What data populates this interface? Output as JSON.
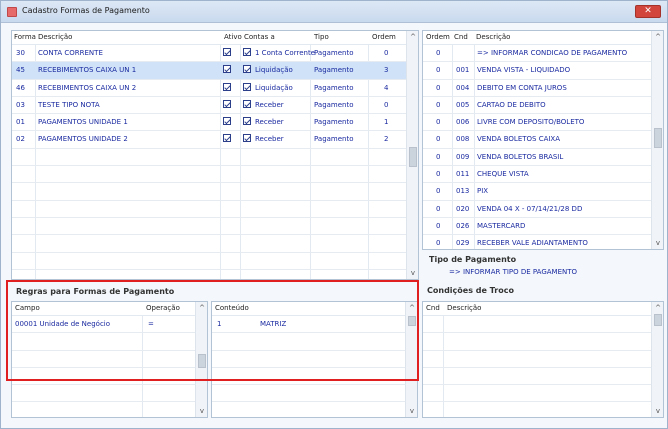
{
  "window": {
    "title": "Cadastro Formas de Pagamento"
  },
  "formas": {
    "headers": [
      "Forma",
      "Descrição",
      "Ativo",
      "Contas a",
      "Tipo",
      "Ordem"
    ],
    "rows": [
      {
        "forma": "30",
        "descricao": "CONTA CORRENTE",
        "ativo": true,
        "contas": "1 Conta Corrente",
        "tipo": "Pagamento",
        "ordem": "0"
      },
      {
        "forma": "45",
        "descricao": "RECEBIMENTOS CAIXA UN 1",
        "ativo": true,
        "contas": "Liquidação",
        "tipo": "Pagamento",
        "ordem": "3"
      },
      {
        "forma": "46",
        "descricao": "RECEBIMENTOS CAIXA UN 2",
        "ativo": true,
        "contas": "Liquidação",
        "tipo": "Pagamento",
        "ordem": "4"
      },
      {
        "forma": "03",
        "descricao": "TESTE TIPO NOTA",
        "ativo": true,
        "contas": "Receber",
        "tipo": "Pagamento",
        "ordem": "0"
      },
      {
        "forma": "01",
        "descricao": "PAGAMENTOS UNIDADE 1",
        "ativo": true,
        "contas": "Receber",
        "tipo": "Pagamento",
        "ordem": "1"
      },
      {
        "forma": "02",
        "descricao": "PAGAMENTOS UNIDADE 2",
        "ativo": true,
        "contas": "Receber",
        "tipo": "Pagamento",
        "ordem": "2"
      }
    ]
  },
  "condicoes": {
    "headers": [
      "Ordem",
      "Cnd",
      "Descrição"
    ],
    "rows": [
      {
        "ordem": "0",
        "cnd": "",
        "descricao": "=> INFORMAR CONDICAO DE PAGAMENTO"
      },
      {
        "ordem": "0",
        "cnd": "001",
        "descricao": "VENDA VISTA - LIQUIDADO"
      },
      {
        "ordem": "0",
        "cnd": "004",
        "descricao": "DEBITO EM CONTA JUROS"
      },
      {
        "ordem": "0",
        "cnd": "005",
        "descricao": "CARTAO DE DEBITO"
      },
      {
        "ordem": "0",
        "cnd": "006",
        "descricao": "LIVRE COM DEPOSITO/BOLETO"
      },
      {
        "ordem": "0",
        "cnd": "008",
        "descricao": "VENDA BOLETOS CAIXA"
      },
      {
        "ordem": "0",
        "cnd": "009",
        "descricao": "VENDA BOLETOS BRASIL"
      },
      {
        "ordem": "0",
        "cnd": "011",
        "descricao": "CHEQUE VISTA"
      },
      {
        "ordem": "0",
        "cnd": "013",
        "descricao": "PIX"
      },
      {
        "ordem": "0",
        "cnd": "020",
        "descricao": "VENDA 04 X - 07/14/21/28 DD"
      },
      {
        "ordem": "0",
        "cnd": "026",
        "descricao": "MASTERCARD"
      },
      {
        "ordem": "0",
        "cnd": "029",
        "descricao": "RECEBER VALE ADIANTAMENTO"
      }
    ]
  },
  "tipo_pagamento": {
    "label": "Tipo de Pagamento",
    "value": "=> INFORMAR TIPO DE PAGAMENTO"
  },
  "regras": {
    "label": "Regras para Formas de Pagamento",
    "headers": [
      "Campo",
      "Operação"
    ],
    "rows": [
      {
        "campo": "00001 Unidade de Negócio",
        "operacao": "="
      }
    ]
  },
  "conteudo": {
    "headers": [
      "Conteúdo"
    ],
    "rows": [
      {
        "n": "1",
        "valor": "MATRIZ"
      }
    ]
  },
  "troco": {
    "label": "Condições de Troco",
    "headers": [
      "Cnd",
      "Descrição"
    ]
  },
  "colors": {
    "selection": "#3a78d4",
    "highlight_box": "#e02020",
    "text": "#1a2aa0"
  }
}
